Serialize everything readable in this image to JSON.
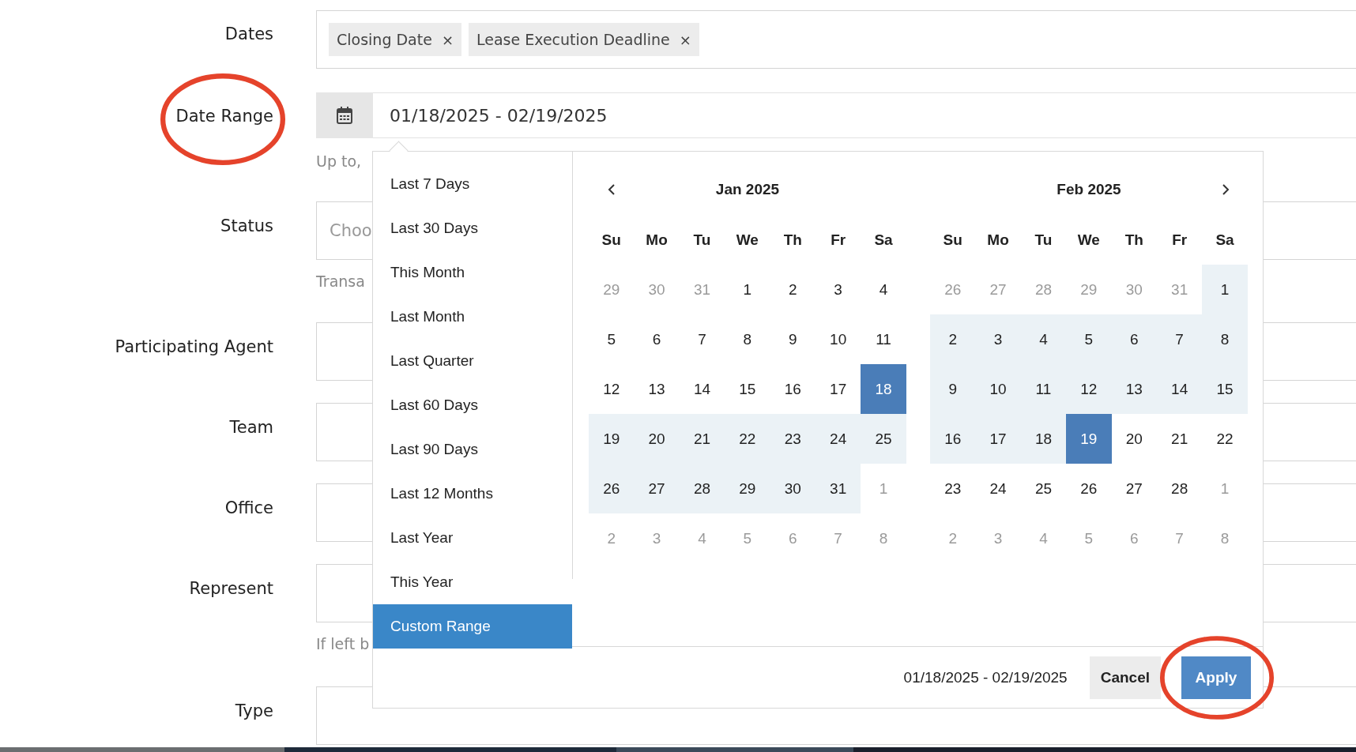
{
  "form": [
    {
      "kind": "tags",
      "label": "Dates",
      "tags": [
        {
          "text": "Closing Date",
          "remove": "×"
        },
        {
          "text": "Lease Execution Deadline",
          "remove": "×"
        }
      ]
    },
    {
      "kind": "date",
      "label": "Date Range",
      "value": "01/18/2025 - 02/19/2025",
      "hint": "Up to,",
      "circled": true
    },
    {
      "kind": "select",
      "label": "Status",
      "placeholder": "Choo",
      "hint": "Transa"
    },
    {
      "kind": "select",
      "label": "Participating Agent"
    },
    {
      "kind": "select",
      "label": "Team"
    },
    {
      "kind": "select",
      "label": "Office"
    },
    {
      "kind": "select",
      "label": "Represent",
      "hint": "If left b"
    },
    {
      "kind": "select",
      "label": "Type"
    }
  ],
  "picker": {
    "ranges": [
      {
        "label": "Last 7 Days",
        "selected": false
      },
      {
        "label": "Last 30 Days",
        "selected": false
      },
      {
        "label": "This Month",
        "selected": false
      },
      {
        "label": "Last Month",
        "selected": false
      },
      {
        "label": "Last Quarter",
        "selected": false
      },
      {
        "label": "Last 60 Days",
        "selected": false
      },
      {
        "label": "Last 90 Days",
        "selected": false
      },
      {
        "label": "Last 12 Months",
        "selected": false
      },
      {
        "label": "Last Year",
        "selected": false
      },
      {
        "label": "This Year",
        "selected": false
      },
      {
        "label": "Custom Range",
        "selected": true
      }
    ],
    "calendars": [
      {
        "month": "Jan 2025",
        "prev_arrow": true,
        "next_arrow": false,
        "weekdays": [
          "Su",
          "Mo",
          "Tu",
          "We",
          "Th",
          "Fr",
          "Sa"
        ],
        "weeks": [
          [
            {
              "d": "29",
              "outside": true,
              "in_range": false,
              "selected": false
            },
            {
              "d": "30",
              "outside": true,
              "in_range": false,
              "selected": false
            },
            {
              "d": "31",
              "outside": true,
              "in_range": false,
              "selected": false
            },
            {
              "d": "1",
              "outside": false,
              "in_range": false,
              "selected": false
            },
            {
              "d": "2",
              "outside": false,
              "in_range": false,
              "selected": false
            },
            {
              "d": "3",
              "outside": false,
              "in_range": false,
              "selected": false
            },
            {
              "d": "4",
              "outside": false,
              "in_range": false,
              "selected": false
            }
          ],
          [
            {
              "d": "5",
              "outside": false,
              "in_range": false,
              "selected": false
            },
            {
              "d": "6",
              "outside": false,
              "in_range": false,
              "selected": false
            },
            {
              "d": "7",
              "outside": false,
              "in_range": false,
              "selected": false
            },
            {
              "d": "8",
              "outside": false,
              "in_range": false,
              "selected": false
            },
            {
              "d": "9",
              "outside": false,
              "in_range": false,
              "selected": false
            },
            {
              "d": "10",
              "outside": false,
              "in_range": false,
              "selected": false
            },
            {
              "d": "11",
              "outside": false,
              "in_range": false,
              "selected": false
            }
          ],
          [
            {
              "d": "12",
              "outside": false,
              "in_range": false,
              "selected": false
            },
            {
              "d": "13",
              "outside": false,
              "in_range": false,
              "selected": false
            },
            {
              "d": "14",
              "outside": false,
              "in_range": false,
              "selected": false
            },
            {
              "d": "15",
              "outside": false,
              "in_range": false,
              "selected": false
            },
            {
              "d": "16",
              "outside": false,
              "in_range": false,
              "selected": false
            },
            {
              "d": "17",
              "outside": false,
              "in_range": false,
              "selected": false
            },
            {
              "d": "18",
              "outside": false,
              "in_range": true,
              "selected": true
            }
          ],
          [
            {
              "d": "19",
              "outside": false,
              "in_range": true,
              "selected": false
            },
            {
              "d": "20",
              "outside": false,
              "in_range": true,
              "selected": false
            },
            {
              "d": "21",
              "outside": false,
              "in_range": true,
              "selected": false
            },
            {
              "d": "22",
              "outside": false,
              "in_range": true,
              "selected": false
            },
            {
              "d": "23",
              "outside": false,
              "in_range": true,
              "selected": false
            },
            {
              "d": "24",
              "outside": false,
              "in_range": true,
              "selected": false
            },
            {
              "d": "25",
              "outside": false,
              "in_range": true,
              "selected": false
            }
          ],
          [
            {
              "d": "26",
              "outside": false,
              "in_range": true,
              "selected": false
            },
            {
              "d": "27",
              "outside": false,
              "in_range": true,
              "selected": false
            },
            {
              "d": "28",
              "outside": false,
              "in_range": true,
              "selected": false
            },
            {
              "d": "29",
              "outside": false,
              "in_range": true,
              "selected": false
            },
            {
              "d": "30",
              "outside": false,
              "in_range": true,
              "selected": false
            },
            {
              "d": "31",
              "outside": false,
              "in_range": true,
              "selected": false
            },
            {
              "d": "1",
              "outside": true,
              "in_range": false,
              "selected": false
            }
          ],
          [
            {
              "d": "2",
              "outside": true,
              "in_range": false,
              "selected": false
            },
            {
              "d": "3",
              "outside": true,
              "in_range": false,
              "selected": false
            },
            {
              "d": "4",
              "outside": true,
              "in_range": false,
              "selected": false
            },
            {
              "d": "5",
              "outside": true,
              "in_range": false,
              "selected": false
            },
            {
              "d": "6",
              "outside": true,
              "in_range": false,
              "selected": false
            },
            {
              "d": "7",
              "outside": true,
              "in_range": false,
              "selected": false
            },
            {
              "d": "8",
              "outside": true,
              "in_range": false,
              "selected": false
            }
          ]
        ]
      },
      {
        "month": "Feb 2025",
        "prev_arrow": false,
        "next_arrow": true,
        "weekdays": [
          "Su",
          "Mo",
          "Tu",
          "We",
          "Th",
          "Fr",
          "Sa"
        ],
        "weeks": [
          [
            {
              "d": "26",
              "outside": true,
              "in_range": false,
              "selected": false
            },
            {
              "d": "27",
              "outside": true,
              "in_range": false,
              "selected": false
            },
            {
              "d": "28",
              "outside": true,
              "in_range": false,
              "selected": false
            },
            {
              "d": "29",
              "outside": true,
              "in_range": false,
              "selected": false
            },
            {
              "d": "30",
              "outside": true,
              "in_range": false,
              "selected": false
            },
            {
              "d": "31",
              "outside": true,
              "in_range": false,
              "selected": false
            },
            {
              "d": "1",
              "outside": false,
              "in_range": true,
              "selected": false
            }
          ],
          [
            {
              "d": "2",
              "outside": false,
              "in_range": true,
              "selected": false
            },
            {
              "d": "3",
              "outside": false,
              "in_range": true,
              "selected": false
            },
            {
              "d": "4",
              "outside": false,
              "in_range": true,
              "selected": false
            },
            {
              "d": "5",
              "outside": false,
              "in_range": true,
              "selected": false
            },
            {
              "d": "6",
              "outside": false,
              "in_range": true,
              "selected": false
            },
            {
              "d": "7",
              "outside": false,
              "in_range": true,
              "selected": false
            },
            {
              "d": "8",
              "outside": false,
              "in_range": true,
              "selected": false
            }
          ],
          [
            {
              "d": "9",
              "outside": false,
              "in_range": true,
              "selected": false
            },
            {
              "d": "10",
              "outside": false,
              "in_range": true,
              "selected": false
            },
            {
              "d": "11",
              "outside": false,
              "in_range": true,
              "selected": false
            },
            {
              "d": "12",
              "outside": false,
              "in_range": true,
              "selected": false
            },
            {
              "d": "13",
              "outside": false,
              "in_range": true,
              "selected": false
            },
            {
              "d": "14",
              "outside": false,
              "in_range": true,
              "selected": false
            },
            {
              "d": "15",
              "outside": false,
              "in_range": true,
              "selected": false
            }
          ],
          [
            {
              "d": "16",
              "outside": false,
              "in_range": true,
              "selected": false
            },
            {
              "d": "17",
              "outside": false,
              "in_range": true,
              "selected": false
            },
            {
              "d": "18",
              "outside": false,
              "in_range": true,
              "selected": false
            },
            {
              "d": "19",
              "outside": false,
              "in_range": true,
              "selected": true
            },
            {
              "d": "20",
              "outside": false,
              "in_range": false,
              "selected": false
            },
            {
              "d": "21",
              "outside": false,
              "in_range": false,
              "selected": false
            },
            {
              "d": "22",
              "outside": false,
              "in_range": false,
              "selected": false
            }
          ],
          [
            {
              "d": "23",
              "outside": false,
              "in_range": false,
              "selected": false
            },
            {
              "d": "24",
              "outside": false,
              "in_range": false,
              "selected": false
            },
            {
              "d": "25",
              "outside": false,
              "in_range": false,
              "selected": false
            },
            {
              "d": "26",
              "outside": false,
              "in_range": false,
              "selected": false
            },
            {
              "d": "27",
              "outside": false,
              "in_range": false,
              "selected": false
            },
            {
              "d": "28",
              "outside": false,
              "in_range": false,
              "selected": false
            },
            {
              "d": "1",
              "outside": true,
              "in_range": false,
              "selected": false
            }
          ],
          [
            {
              "d": "2",
              "outside": true,
              "in_range": false,
              "selected": false
            },
            {
              "d": "3",
              "outside": true,
              "in_range": false,
              "selected": false
            },
            {
              "d": "4",
              "outside": true,
              "in_range": false,
              "selected": false
            },
            {
              "d": "5",
              "outside": true,
              "in_range": false,
              "selected": false
            },
            {
              "d": "6",
              "outside": true,
              "in_range": false,
              "selected": false
            },
            {
              "d": "7",
              "outside": true,
              "in_range": false,
              "selected": false
            },
            {
              "d": "8",
              "outside": true,
              "in_range": false,
              "selected": false
            }
          ]
        ]
      }
    ],
    "footer": {
      "range": "01/18/2025 - 02/19/2025",
      "buttons": [
        {
          "kind": "cancel",
          "label": "Cancel",
          "circled": false
        },
        {
          "kind": "apply",
          "label": "Apply",
          "circled": true
        }
      ]
    }
  }
}
